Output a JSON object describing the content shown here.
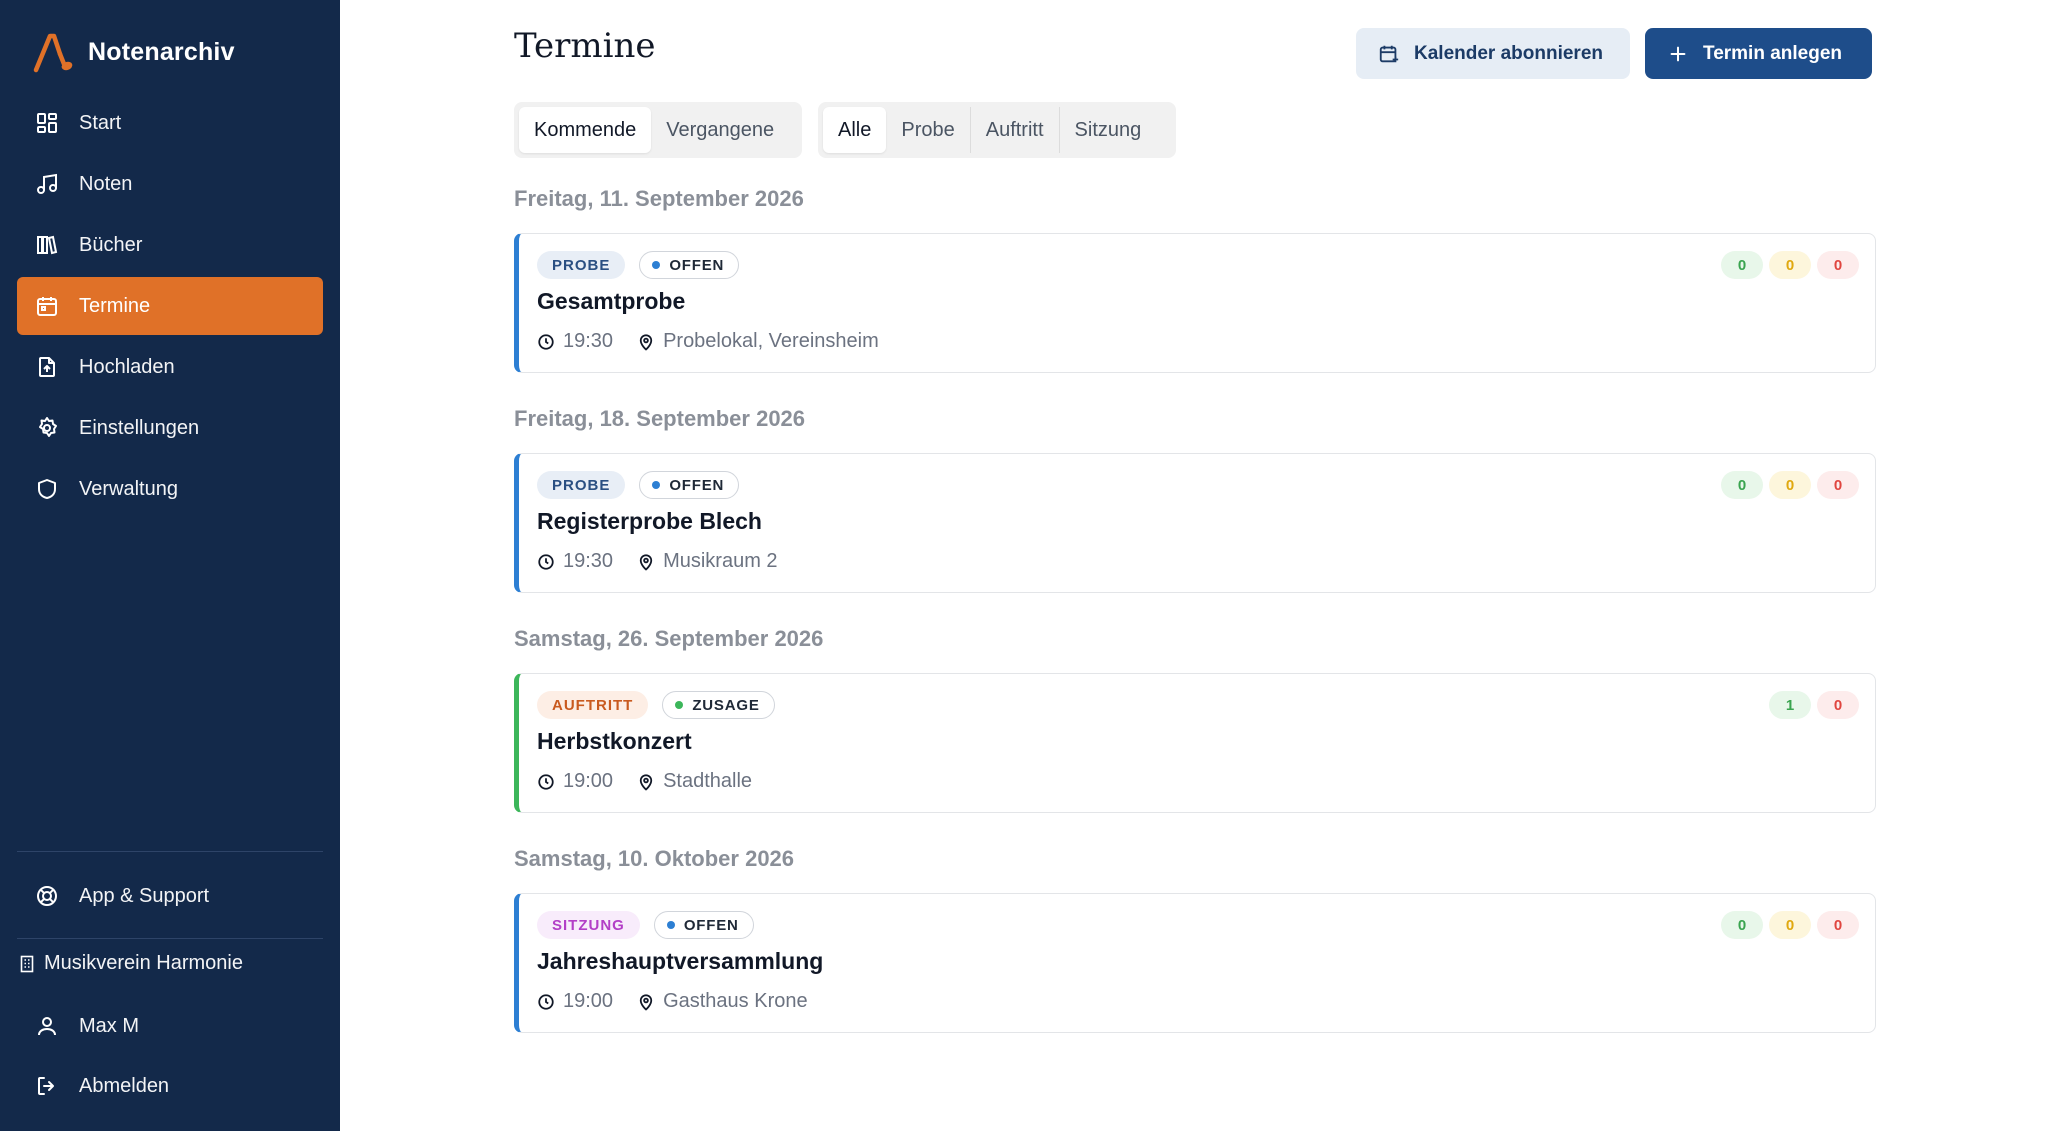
{
  "app": {
    "name": "Notenarchiv"
  },
  "sidebar": {
    "items": [
      {
        "label": "Start",
        "icon": "dashboard-icon"
      },
      {
        "label": "Noten",
        "icon": "music-note-icon"
      },
      {
        "label": "Bücher",
        "icon": "books-icon"
      },
      {
        "label": "Termine",
        "icon": "calendar-icon",
        "active": true
      },
      {
        "label": "Hochladen",
        "icon": "file-upload-icon"
      },
      {
        "label": "Einstellungen",
        "icon": "gear-icon"
      },
      {
        "label": "Verwaltung",
        "icon": "shield-icon"
      }
    ],
    "support": "App & Support",
    "organization": "Musikverein Harmonie",
    "user": "Max M",
    "logout": "Abmelden"
  },
  "page": {
    "title": "Termine",
    "subscribe_label": "Kalender abonnieren",
    "new_label": "Termin anlegen"
  },
  "filters": {
    "time": [
      "Kommende",
      "Vergangene"
    ],
    "time_selected": "Kommende",
    "type": [
      "Alle",
      "Probe",
      "Auftritt",
      "Sitzung"
    ],
    "type_selected": "Alle"
  },
  "days": [
    {
      "date": "Freitag, 11. September 2026",
      "events": [
        {
          "type": "PROBE",
          "status": "OFFEN",
          "title": "Gesamtprobe",
          "time": "19:30",
          "location": "Probelokal, Vereinsheim",
          "counts": [
            "0",
            "0",
            "0"
          ]
        }
      ]
    },
    {
      "date": "Freitag, 18. September 2026",
      "events": [
        {
          "type": "PROBE",
          "status": "OFFEN",
          "title": "Registerprobe Blech",
          "time": "19:30",
          "location": "Musikraum 2",
          "counts": [
            "0",
            "0",
            "0"
          ]
        }
      ]
    },
    {
      "date": "Samstag, 26. September 2026",
      "events": [
        {
          "type": "AUFTRITT",
          "status": "ZUSAGE",
          "title": "Herbstkonzert",
          "time": "19:00",
          "location": "Stadthalle",
          "counts": [
            "1",
            "0"
          ]
        }
      ]
    },
    {
      "date": "Samstag, 10. Oktober 2026",
      "events": [
        {
          "type": "SITZUNG",
          "status": "OFFEN",
          "title": "Jahreshauptversammlung",
          "time": "19:00",
          "location": "Gasthaus Krone",
          "counts": [
            "0",
            "0",
            "0"
          ]
        }
      ]
    }
  ],
  "colors": {
    "sidebar_bg": "#13294a",
    "accent_orange": "#e07128",
    "primary_blue": "#1e4d8a",
    "probe_border": "#2d7fd3",
    "auftritt_border": "#3cb65a",
    "status_offen_dot": "#2d7fd3",
    "status_zusage_dot": "#3cb65a"
  }
}
